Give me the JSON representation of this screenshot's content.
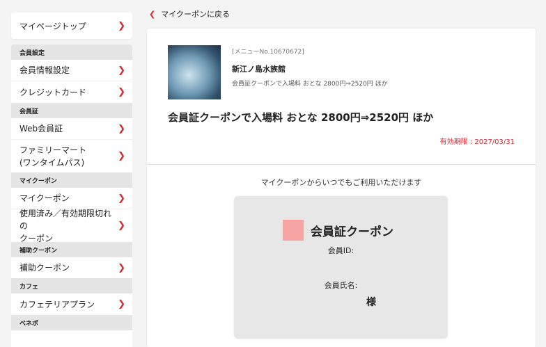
{
  "sidebar": {
    "top_item": {
      "label": "マイページトップ"
    },
    "sections": [
      {
        "heading": "会員設定",
        "items": [
          {
            "label": "会員情報設定"
          },
          {
            "label": "クレジットカード"
          }
        ]
      },
      {
        "heading": "会員証",
        "items": [
          {
            "label": "Web会員証"
          },
          {
            "label": "ファミリーマート\n(ワンタイムパス)"
          }
        ]
      },
      {
        "heading": "マイクーポン",
        "items": [
          {
            "label": "マイクーポン"
          },
          {
            "label": "使用済み／有効期限切れの\nクーポン"
          }
        ]
      },
      {
        "heading": "補助クーポン",
        "items": [
          {
            "label": "補助クーポン"
          }
        ]
      },
      {
        "heading": "カフェ",
        "items": [
          {
            "label": "カフェテリアプラン"
          }
        ]
      },
      {
        "heading": "ベネポ",
        "items": []
      }
    ]
  },
  "back_link": {
    "label": "マイクーポンに戻る"
  },
  "coupon_detail": {
    "menu_no": "[メニューNo.10670672]",
    "shop_name": "新江ノ島水族館",
    "short_description": "会員証クーポンで入場料 おとな 2800円⇒2520円 ほか",
    "headline": "会員証クーポンで入場料 おとな 2800円⇒2520円 ほか",
    "expiry": "有効期限 : 2027/03/31",
    "info_text": "マイクーポンからいつでもご利用いただけます"
  },
  "member_card": {
    "title": "会員証クーポン",
    "member_id_label": "会員ID:",
    "member_name_label": "会員氏名:",
    "honorific": "様"
  },
  "icons": {
    "chevron": "chevron-right-icon",
    "back": "chevron-left-icon"
  },
  "colors": {
    "accent": "#d7262c",
    "coupon_mark": "#f6a4a4"
  }
}
